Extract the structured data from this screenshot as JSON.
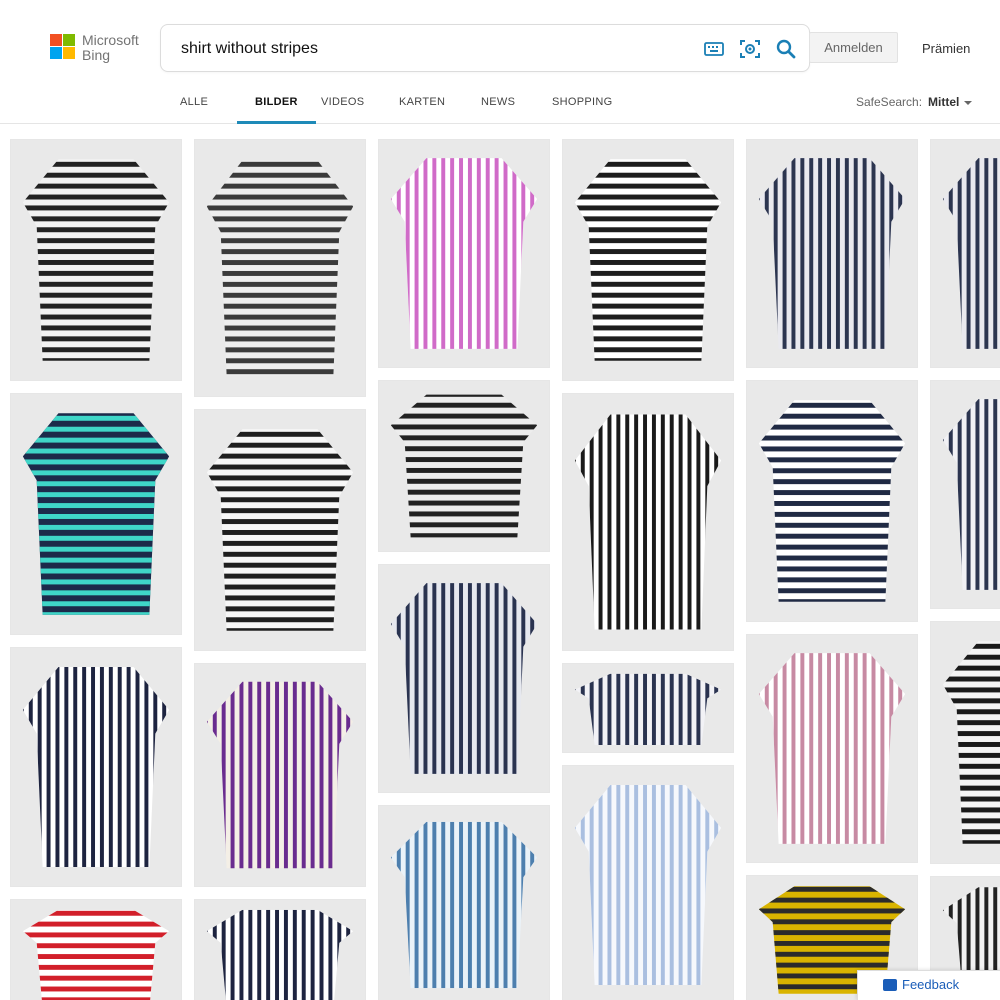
{
  "brand": {
    "line1": "Microsoft",
    "line2": "Bing"
  },
  "search": {
    "query": "shirt without stripes"
  },
  "header": {
    "signin_label": "Anmelden",
    "rewards_label": "Prämien"
  },
  "tabs": [
    {
      "label": "ALLE",
      "active": false
    },
    {
      "label": "BILDER",
      "active": true
    },
    {
      "label": "VIDEOS",
      "active": false
    },
    {
      "label": "KARTEN",
      "active": false
    },
    {
      "label": "NEWS",
      "active": false
    },
    {
      "label": "SHOPPING",
      "active": false
    }
  ],
  "safesearch": {
    "label": "SafeSearch:",
    "value": "Mittel"
  },
  "icons": {
    "keyboard": "keyboard-icon",
    "visual_search": "visual-search-icon",
    "search": "search-icon",
    "dropdown": "chevron-down-icon",
    "feedback": "feedback-icon"
  },
  "colors": {
    "accent": "#1e8ab8",
    "link": "#1a5db8",
    "logo_red": "#f25022",
    "logo_green": "#7fba00",
    "logo_blue": "#00a4ef",
    "logo_yellow": "#ffb900"
  },
  "results": [
    {
      "name": "image-result-laceup-striped-bodysuit",
      "palette": [
        "#222222",
        "#f2f2f2"
      ],
      "stripe": "h"
    },
    {
      "name": "image-result-grey-striped-tie-tee",
      "palette": [
        "#3b3b3b",
        "#eeeeee"
      ],
      "stripe": "h"
    },
    {
      "name": "image-result-pink-striped-shirt-collar",
      "palette": [
        "#d06bc8",
        "#ffffff"
      ],
      "stripe": "v"
    },
    {
      "name": "image-result-nursing-striped-top",
      "palette": [
        "#1d1d1d",
        "#ffffff"
      ],
      "stripe": "h"
    },
    {
      "name": "image-result-navy-striped-shirt-man",
      "palette": [
        "#2c3550",
        "#e9e9ef"
      ],
      "stripe": "v"
    },
    {
      "name": "image-result-navy-striped-shirt-cropped",
      "palette": [
        "#2c3550",
        "#e9e9ef"
      ],
      "stripe": "v"
    },
    {
      "name": "image-result-turquoise-striped-tee",
      "palette": [
        "#3fd6c8",
        "#1c2a4a"
      ],
      "stripe": "h"
    },
    {
      "name": "image-result-white-black-striped-longsleeve",
      "palette": [
        "#1f1f1f",
        "#f7f7f7"
      ],
      "stripe": "h"
    },
    {
      "name": "image-result-striped-tee-black-pants",
      "palette": [
        "#222222",
        "#ededed"
      ],
      "stripe": "h"
    },
    {
      "name": "image-result-black-white-striped-blouse",
      "palette": [
        "#1a1a1a",
        "#ffffff"
      ],
      "stripe": "v"
    },
    {
      "name": "image-result-offshoulder-striped-top",
      "palette": [
        "#202a44",
        "#ffffff"
      ],
      "stripe": "h"
    },
    {
      "name": "image-result-navy-striped-shirt-side",
      "palette": [
        "#2c3550",
        "#f1f1f5"
      ],
      "stripe": "v"
    },
    {
      "name": "image-result-navy-striped-shirt-white-collar",
      "palette": [
        "#1e2440",
        "#ffffff"
      ],
      "stripe": "v"
    },
    {
      "name": "image-result-purple-striped-tunic",
      "palette": [
        "#6a2c8f",
        "#f4efe6"
      ],
      "stripe": "v"
    },
    {
      "name": "image-result-striped-shirt-back-view",
      "palette": [
        "#2a3350",
        "#e6e8ef"
      ],
      "stripe": "v"
    },
    {
      "name": "image-result-small-striped-dress-shirt",
      "palette": [
        "#2a3350",
        "#f2f2f6"
      ],
      "stripe": "v"
    },
    {
      "name": "image-result-pink-striped-shirt-man",
      "palette": [
        "#c78aa3",
        "#ffffff"
      ],
      "stripe": "v"
    },
    {
      "name": "image-result-black-striped-tee-woman",
      "palette": [
        "#1a1a1a",
        "#f4f4f4"
      ],
      "stripe": "h"
    },
    {
      "name": "image-result-red-striped-tee",
      "palette": [
        "#d21f2a",
        "#ffffff"
      ],
      "stripe": "h"
    },
    {
      "name": "image-result-navy-striped-shirt-large",
      "palette": [
        "#1e2440",
        "#ffffff"
      ],
      "stripe": "v"
    },
    {
      "name": "image-result-blue-striped-shirt-mannequin",
      "palette": [
        "#4d7fae",
        "#eaf2f8"
      ],
      "stripe": "v"
    },
    {
      "name": "image-result-light-blue-shirt-woman",
      "palette": [
        "#aabfe0",
        "#f6f8fc"
      ],
      "stripe": "v"
    },
    {
      "name": "image-result-colorful-striped-blouse",
      "palette": [
        "#2b2b2b",
        "#d9b400"
      ],
      "stripe": "h"
    },
    {
      "name": "image-result-striped-shirt-cropped-corner",
      "palette": [
        "#222222",
        "#f2f2f2"
      ],
      "stripe": "v"
    }
  ],
  "feedback": {
    "label": "Feedback"
  }
}
